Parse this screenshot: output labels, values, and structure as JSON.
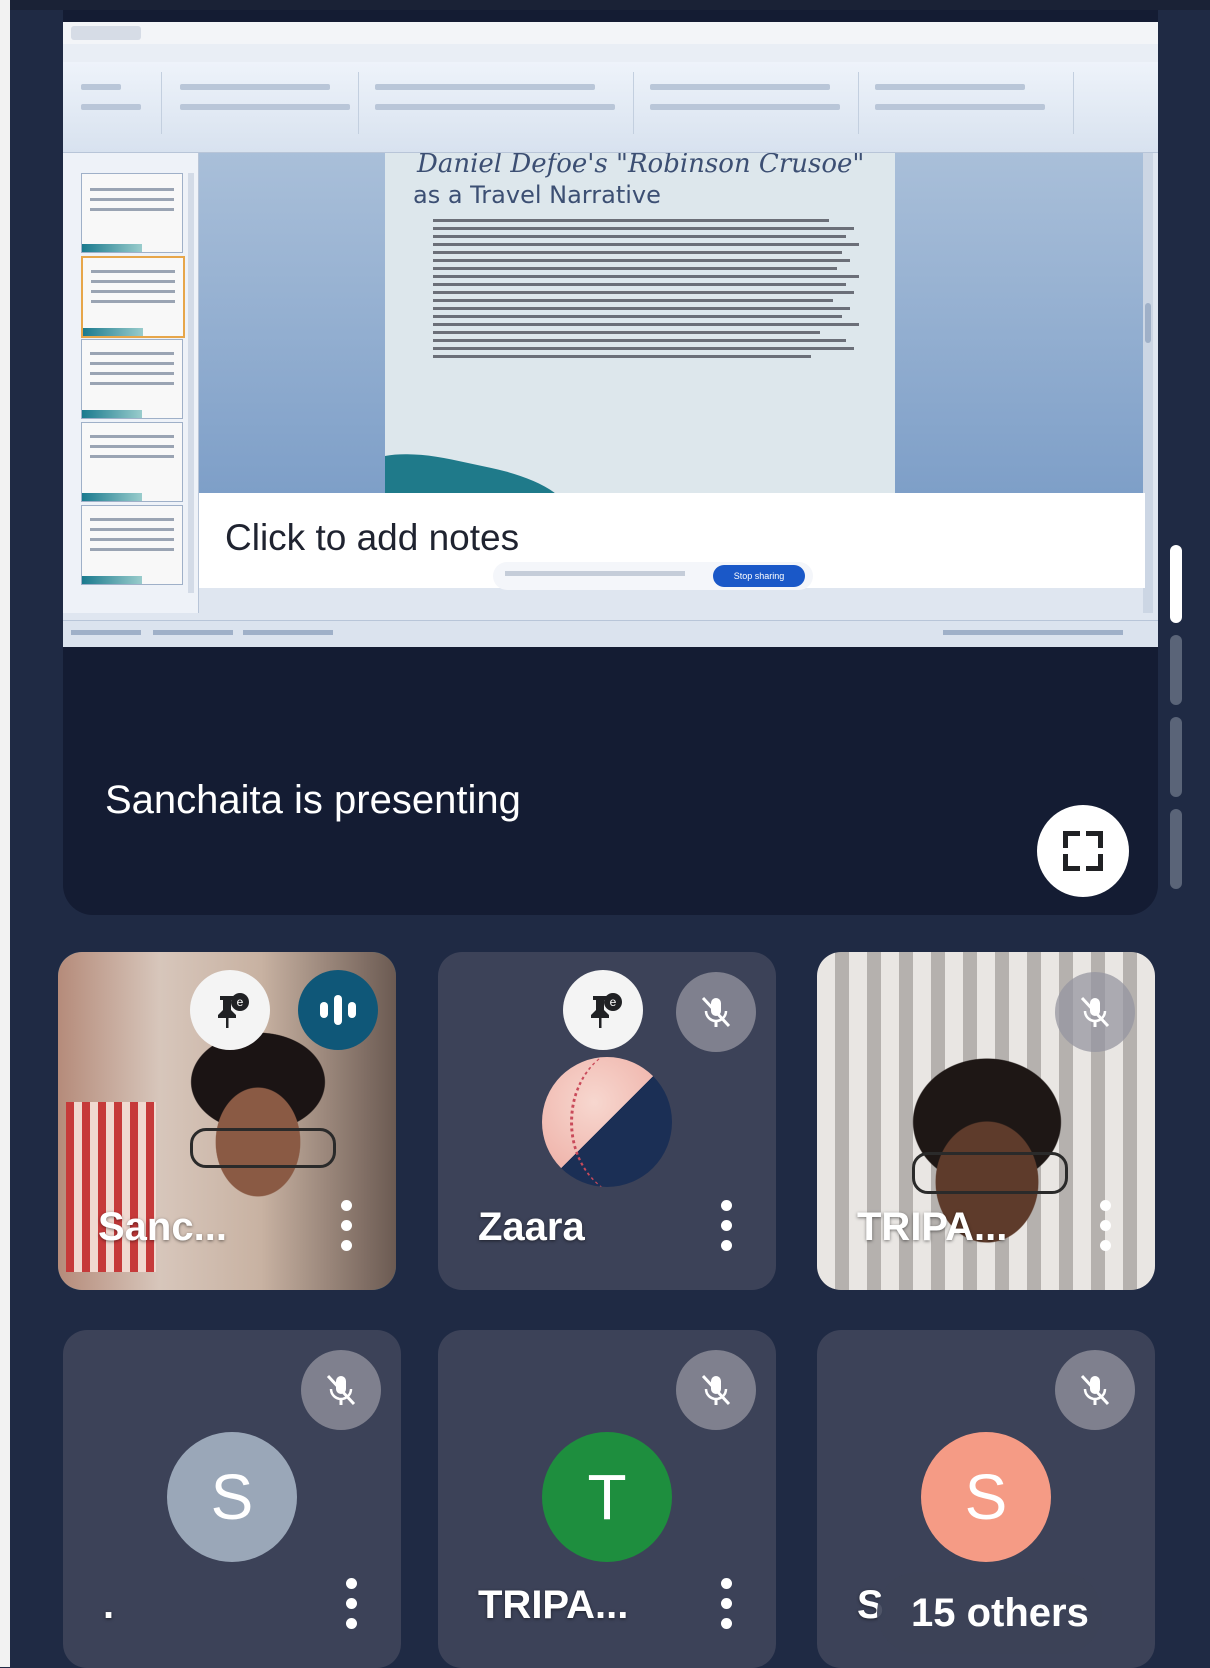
{
  "presentation": {
    "window_title": "",
    "slide": {
      "title_line1": "Daniel Defoe's \"Robinson Crusoe\"",
      "title_line2": "as a Travel Narrative"
    },
    "notes_placeholder": "Click to add notes",
    "stop_sharing_label": "Stop sharing",
    "presenter_label": "Sanchaita is presenting"
  },
  "participants": [
    {
      "name": "Sanc...",
      "has_pin": true,
      "speaking": true,
      "muted": false,
      "kind": "video"
    },
    {
      "name": "Zaara",
      "has_pin": true,
      "speaking": false,
      "muted": true,
      "kind": "avatar-image"
    },
    {
      "name": "TRIPA...",
      "has_pin": false,
      "speaking": false,
      "muted": true,
      "kind": "video"
    },
    {
      "name": ".",
      "avatar_letter": "S",
      "avatar_color": "#9aa7b8",
      "muted": true,
      "kind": "avatar-letter"
    },
    {
      "name": "TRIPA...",
      "avatar_letter": "T",
      "avatar_color": "#1e8e3e",
      "muted": true,
      "kind": "avatar-letter"
    },
    {
      "name": "S",
      "avatar_letter": "S",
      "avatar_color": "#f59b85",
      "muted": true,
      "kind": "avatar-letter",
      "overflow_label": "15 others"
    }
  ],
  "icons": {
    "fullscreen": "fullscreen-icon",
    "mic_off": "mic-off-icon",
    "pin": "pin-icon",
    "speaking": "audio-level-icon",
    "more": "more-vert-icon"
  },
  "colors": {
    "background": "#1f2a44",
    "present_card": "#141c33",
    "tile": "#3c4258",
    "active_outline": "#1a5d80"
  }
}
